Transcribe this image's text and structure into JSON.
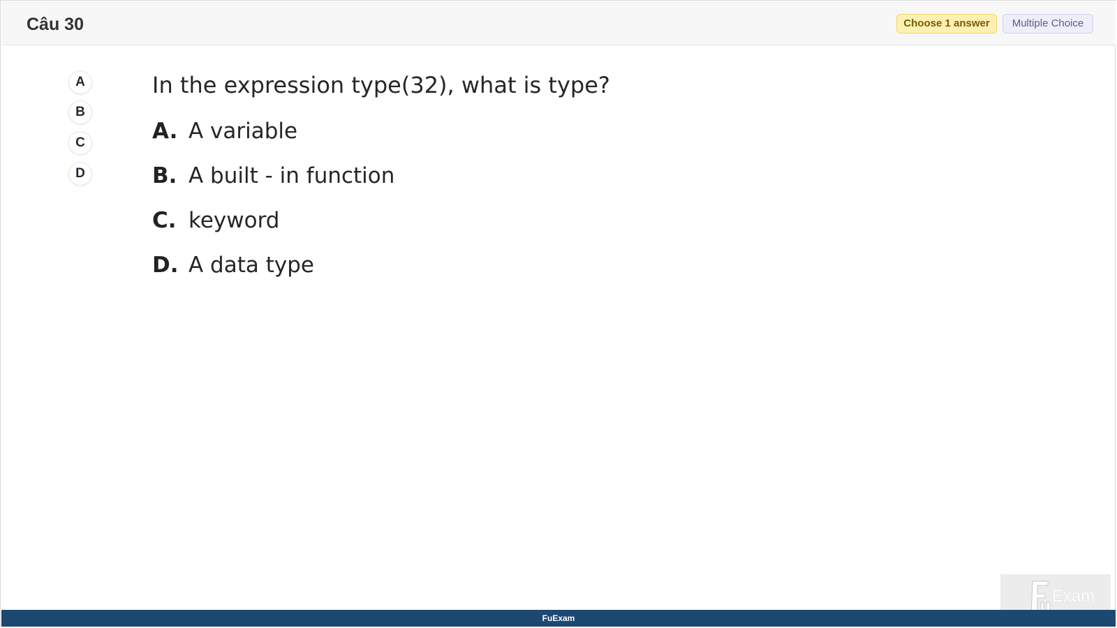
{
  "header": {
    "question_number": "Câu 30",
    "choose_badge": "Choose 1 answer",
    "type_badge": "Multiple Choice"
  },
  "answer_picker": [
    "A",
    "B",
    "C",
    "D"
  ],
  "question": {
    "text": "In the expression type(32), what is type?",
    "options": [
      {
        "letter": "A.",
        "text": "A variable"
      },
      {
        "letter": "B.",
        "text": "A built - in function"
      },
      {
        "letter": "C.",
        "text": "keyword"
      },
      {
        "letter": "D.",
        "text": "A data type"
      }
    ]
  },
  "footer": {
    "brand": "FuExam"
  },
  "watermark": {
    "text": "Exam"
  },
  "colors": {
    "footer_bg": "#1c4872",
    "choose_badge_bg": "#fdf0b2",
    "type_badge_bg": "#eeeefb"
  }
}
